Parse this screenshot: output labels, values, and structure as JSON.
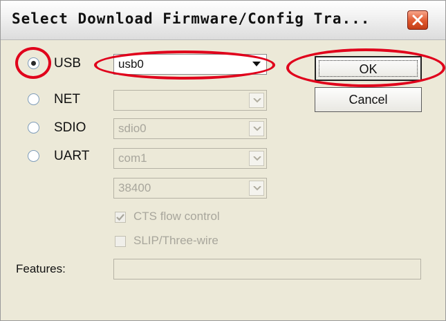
{
  "window": {
    "title": "Select Download Firmware/Config Tra..."
  },
  "interfaces": [
    {
      "label": "USB",
      "selected": true,
      "device": "usb0",
      "enabled": true
    },
    {
      "label": "NET",
      "selected": false,
      "device": "",
      "enabled": false
    },
    {
      "label": "SDIO",
      "selected": false,
      "device": "sdio0",
      "enabled": false
    },
    {
      "label": "UART",
      "selected": false,
      "device": "com1",
      "enabled": false
    }
  ],
  "baud_rate": "38400",
  "checkboxes": {
    "cts": {
      "label": "CTS flow control",
      "checked": true
    },
    "slip": {
      "label": "SLIP/Three-wire",
      "checked": false
    }
  },
  "features": {
    "label": "Features:",
    "value": ""
  },
  "buttons": {
    "ok": "OK",
    "cancel": "Cancel"
  },
  "colors": {
    "highlight_annotation": "#e0001b",
    "dialog_face": "#ece9d8"
  }
}
